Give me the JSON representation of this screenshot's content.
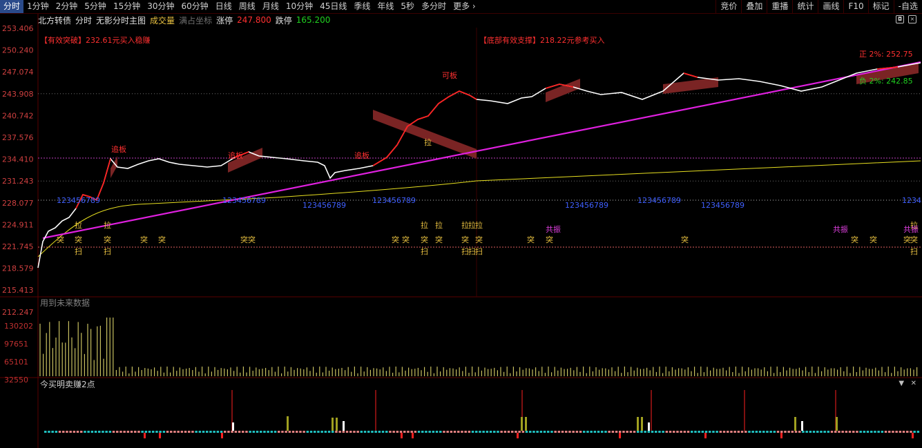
{
  "tabs": [
    "分时",
    "1分钟",
    "2分钟",
    "5分钟",
    "15分钟",
    "30分钟",
    "60分钟",
    "日线",
    "周线",
    "月线",
    "10分钟",
    "45日线",
    "季线",
    "年线",
    "5秒",
    "多分时",
    "更多 ›"
  ],
  "active_tab": 0,
  "right_tabs": [
    "竞价",
    "叠加",
    "重播",
    "统计",
    "画线",
    "F10",
    "标记",
    "-自选"
  ],
  "info": {
    "name": "北方转债",
    "mode": "分时",
    "main_title": "无影分时主图",
    "volume_label": "成交量",
    "full_coord": "满占坐标",
    "limit_up_label": "涨停",
    "limit_up": "247.800",
    "limit_down_label": "跌停",
    "limit_down": "165.200"
  },
  "y_axis": [
    "253.406",
    "250.240",
    "247.074",
    "243.908",
    "240.742",
    "237.576",
    "234.410",
    "231.243",
    "228.077",
    "224.911",
    "221.745",
    "218.579",
    "215.413",
    "212.247"
  ],
  "vol_axis": [
    "130202",
    "97651",
    "65101",
    "32550"
  ],
  "vol_title": "用到未来数据",
  "ind_title": "今买明卖赚2点",
  "signals": {
    "break_text": "【有效突破】232.61元买入稳赚",
    "support_text": "【底部有效支撑】218.22元参考买入",
    "upper_text": "正 2%: 252.75",
    "lower_text": "负 2%: 242.85",
    "chase": "追板",
    "can_board": "可板",
    "pull": "拉",
    "burst": "突",
    "sweep": "扫",
    "resonance": "共振",
    "count_seq": "123456789"
  },
  "colors": {
    "up": "#ff3030",
    "down": "#20d020",
    "price": "#ffffff",
    "avg": "#e8e020",
    "trend": "#e020e0",
    "band": "#8a2a2a"
  }
}
